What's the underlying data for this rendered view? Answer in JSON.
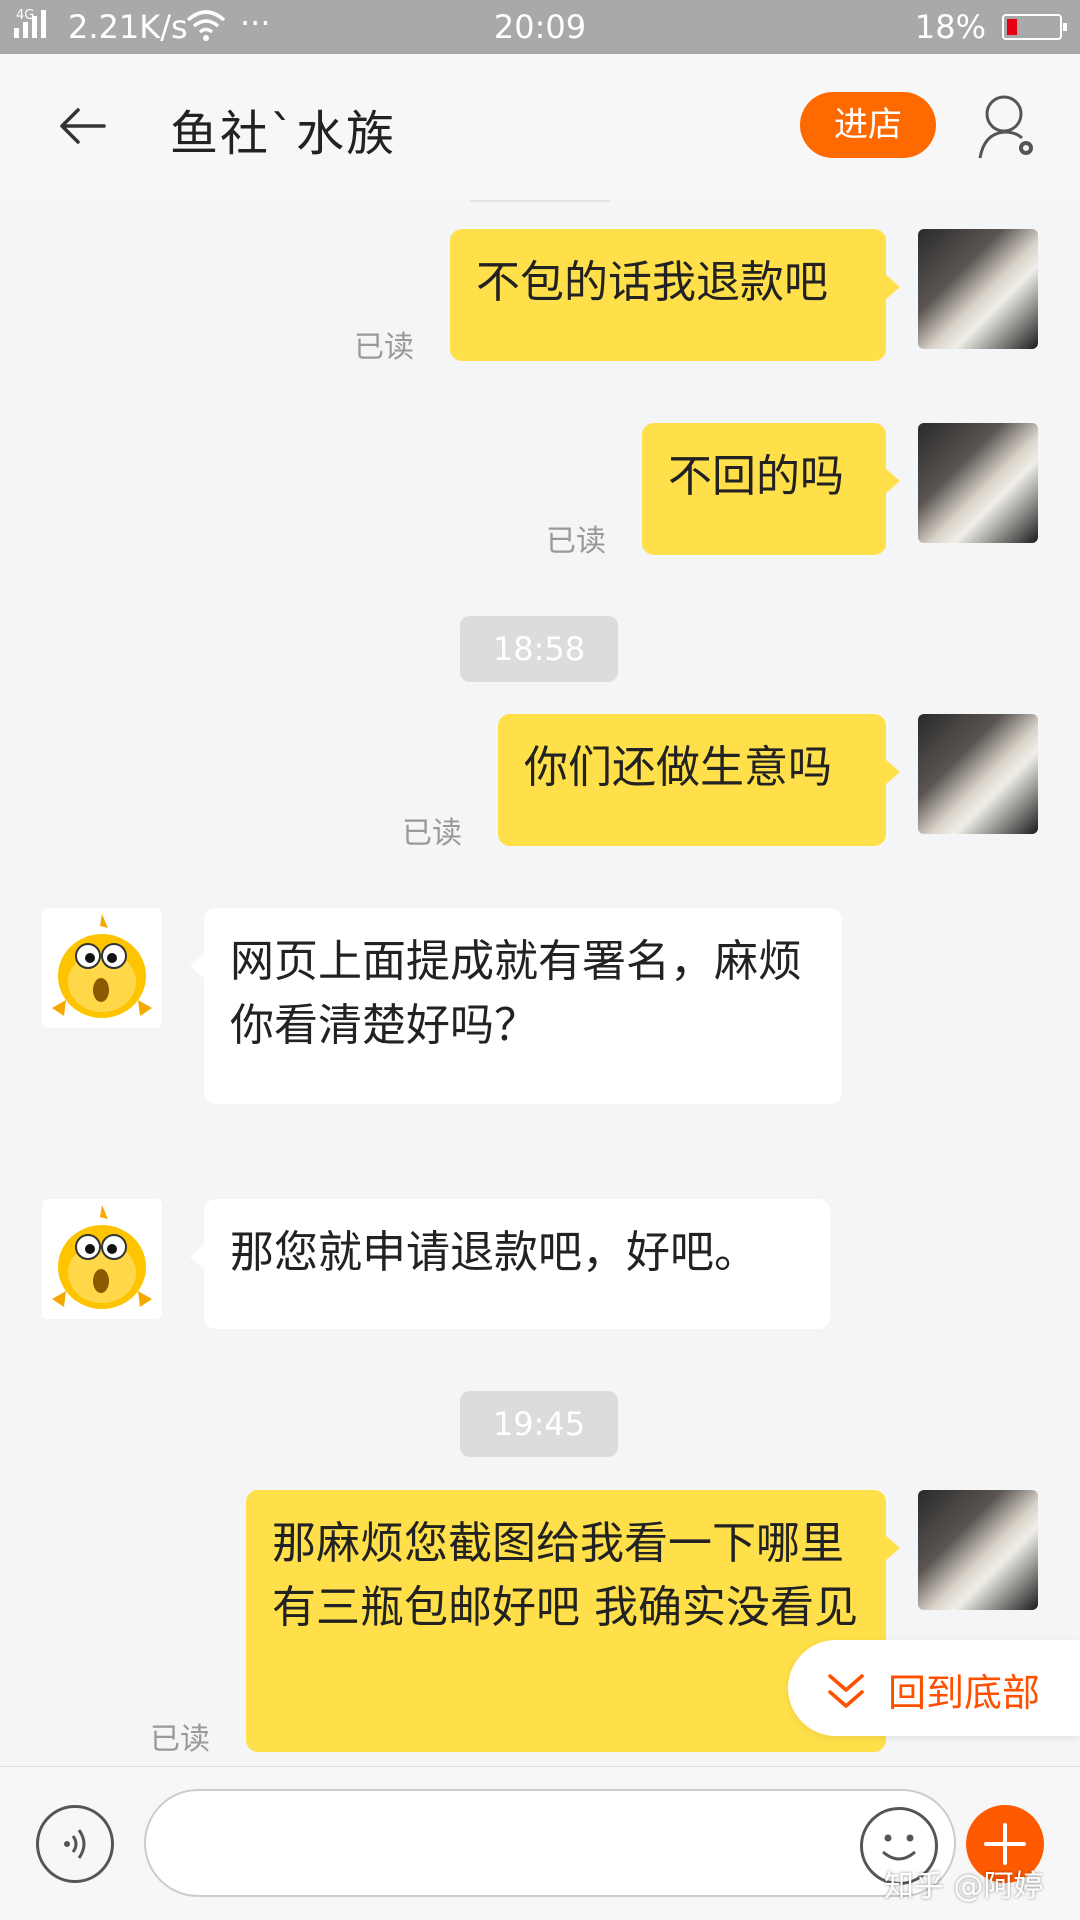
{
  "status_bar": {
    "network": "4G",
    "speed": "2.21K/s",
    "more": "···",
    "time": "20:09",
    "battery_pct": "18%",
    "battery_level": 0.18
  },
  "header": {
    "title": "鱼社`水族",
    "enter_label": "进店"
  },
  "messages": [
    {
      "side": "me",
      "text": "不包的话我退款吧",
      "read": "已读"
    },
    {
      "side": "me",
      "text": "不回的吗",
      "read": "已读"
    },
    {
      "type": "time",
      "text": "18:58"
    },
    {
      "side": "me",
      "text": "你们还做生意吗",
      "read": "已读"
    },
    {
      "side": "shop",
      "text": "网页上面提成就有署名，麻烦你看清楚好吗？"
    },
    {
      "side": "shop",
      "text": "那您就申请退款吧，好吧。"
    },
    {
      "type": "time",
      "text": "19:45"
    },
    {
      "side": "me",
      "text": "那麻烦您截图给我看一下哪里有三瓶包邮好吧 我确实没看见",
      "read": "已读"
    }
  ],
  "scroll_bottom_label": "回到底部",
  "input": {
    "value": "",
    "placeholder": ""
  },
  "watermark": "知乎 @阿婷",
  "colors": {
    "accent": "#ff6a00",
    "my_bubble": "#ffe04a",
    "shop_bubble": "#ffffff"
  }
}
